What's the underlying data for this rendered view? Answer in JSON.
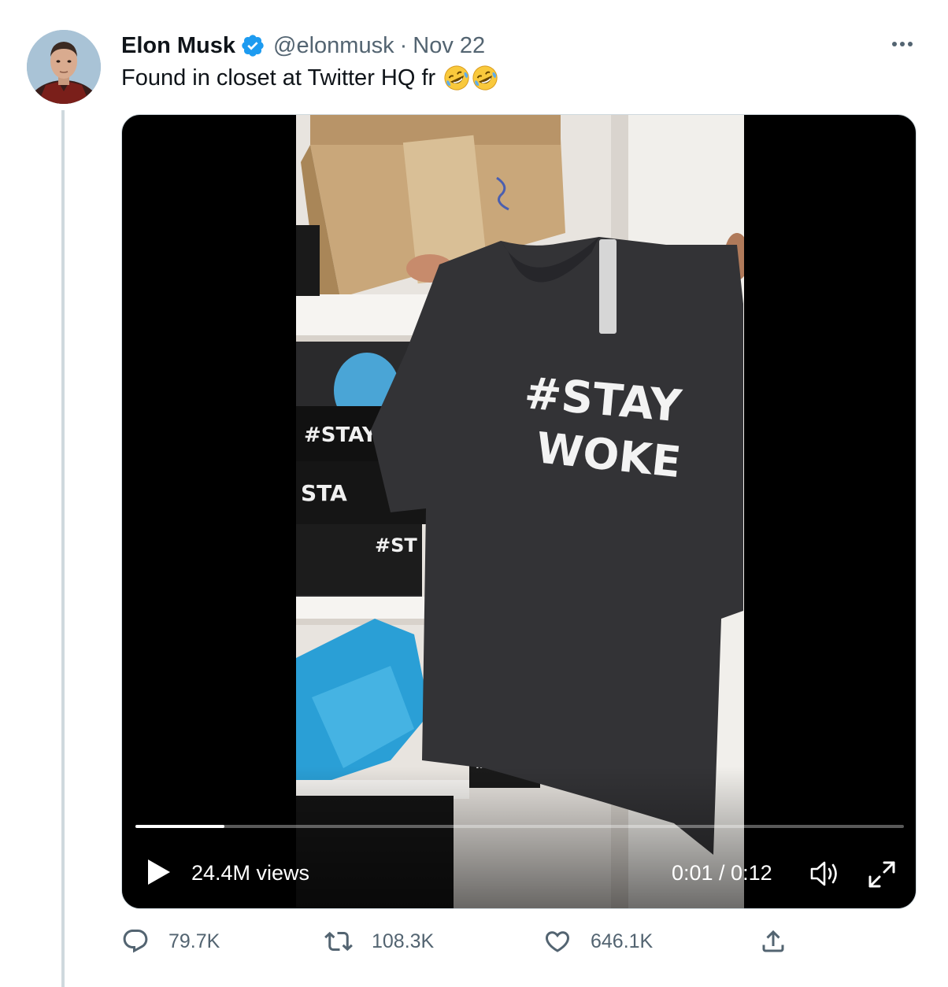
{
  "tweet": {
    "author_name": "Elon Musk",
    "handle": "@elonmusk",
    "separator": "·",
    "date": "Nov 22",
    "text": "Found in closet at Twitter HQ fr",
    "emoji": [
      "rolling-on-floor-laughing",
      "rolling-on-floor-laughing"
    ]
  },
  "video": {
    "views": "24.4M views",
    "time": "0:01 / 0:12",
    "progress": 0.116,
    "shirt_line1": "#STAY",
    "shirt_line2": "WOKE"
  },
  "actions": {
    "replies": "79.7K",
    "retweets": "108.3K",
    "likes": "646.1K"
  },
  "colors": {
    "verified": "#1d9bf0",
    "secondary_text": "#536471",
    "thread_line": "#cfd9de"
  }
}
